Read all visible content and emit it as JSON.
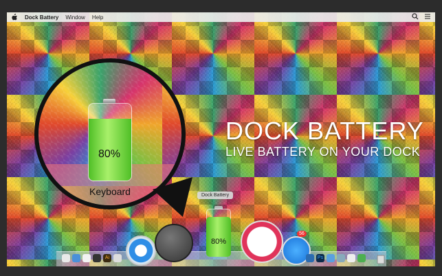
{
  "menubar": {
    "app_name": "Dock Battery",
    "items": [
      "Window",
      "Help"
    ]
  },
  "headline": {
    "title": "DOCK BATTERY",
    "subtitle": "LIVE BATTERY ON YOUR DOCK"
  },
  "magnifier": {
    "battery_percent": "80%",
    "battery_level": 0.8,
    "label": "Keyboard"
  },
  "dock": {
    "tooltip": "Dock Battery",
    "app_store_badge": "56",
    "dock_battery_percent": "80%",
    "dock_battery_label": "keyboard",
    "small_icon_labels": [
      "Ai",
      "Ps"
    ]
  },
  "colors": {
    "battery_green": "#6ad438",
    "menubar": "#ebebeb"
  }
}
